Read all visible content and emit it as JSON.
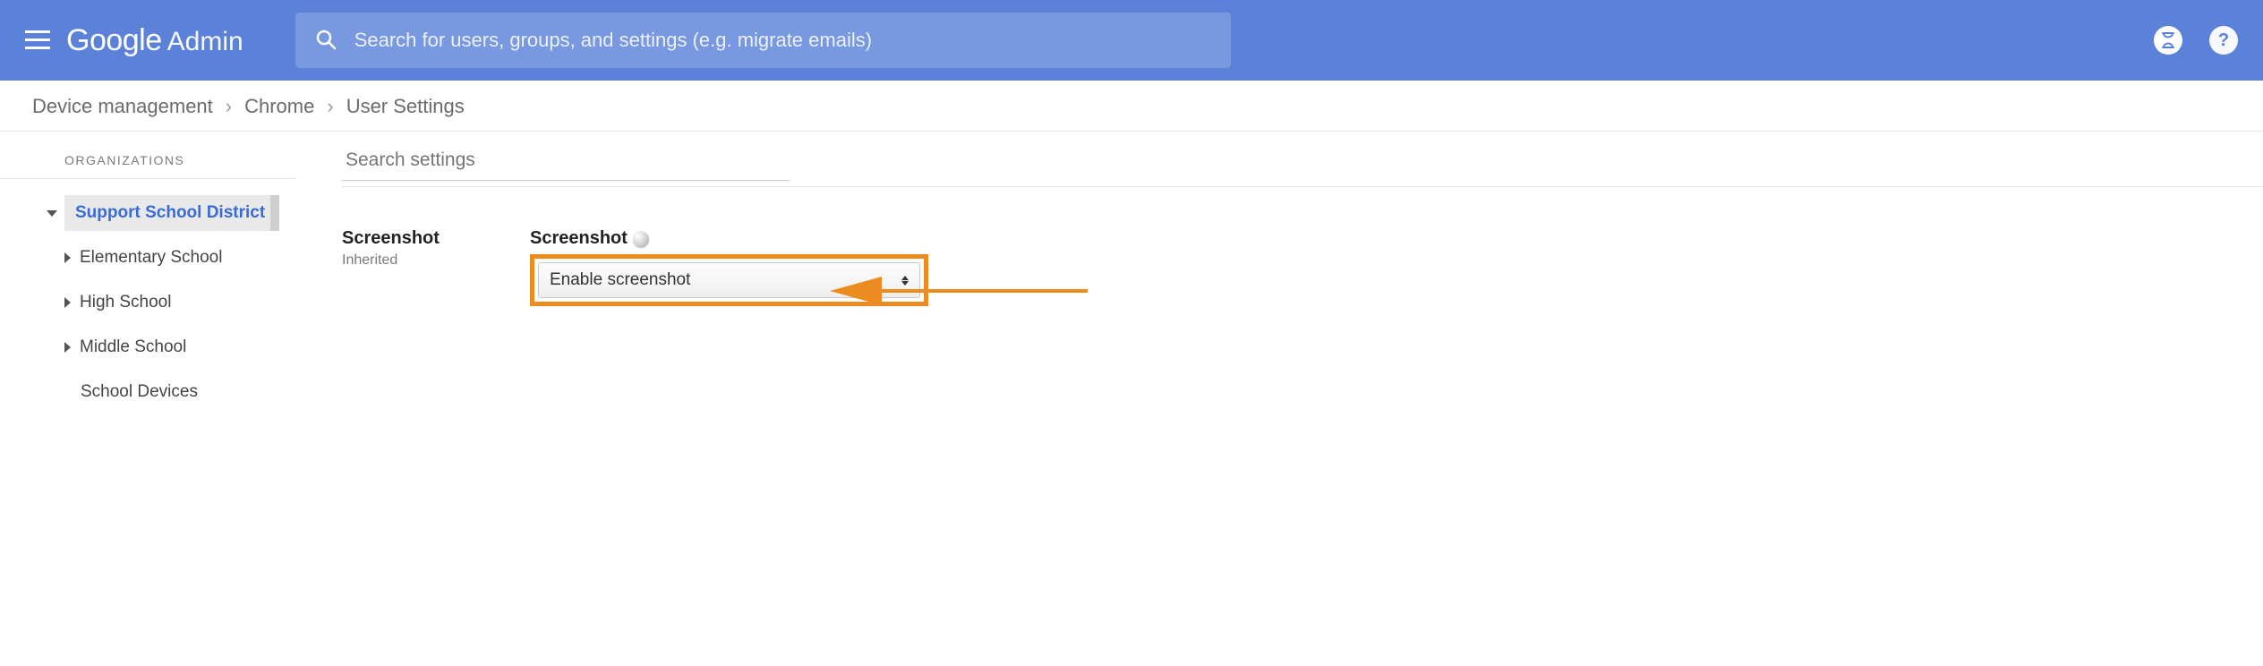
{
  "header": {
    "logo_google": "Google",
    "logo_admin": "Admin",
    "search_placeholder": "Search for users, groups, and settings (e.g. migrate emails)"
  },
  "breadcrumb": {
    "items": [
      "Device management",
      "Chrome",
      "User Settings"
    ]
  },
  "sidebar": {
    "header": "ORGANIZATIONS",
    "tree": {
      "root": {
        "label": "Support School District",
        "selected": true,
        "expanded": true
      },
      "children": [
        {
          "label": "Elementary School",
          "expandable": true
        },
        {
          "label": "High School",
          "expandable": true
        },
        {
          "label": "Middle School",
          "expandable": true
        },
        {
          "label": "School Devices",
          "expandable": false
        }
      ]
    }
  },
  "content": {
    "search_placeholder": "Search settings",
    "setting": {
      "left_title": "Screenshot",
      "left_sub": "Inherited",
      "right_label": "Screenshot",
      "dropdown_value": "Enable screenshot"
    }
  }
}
